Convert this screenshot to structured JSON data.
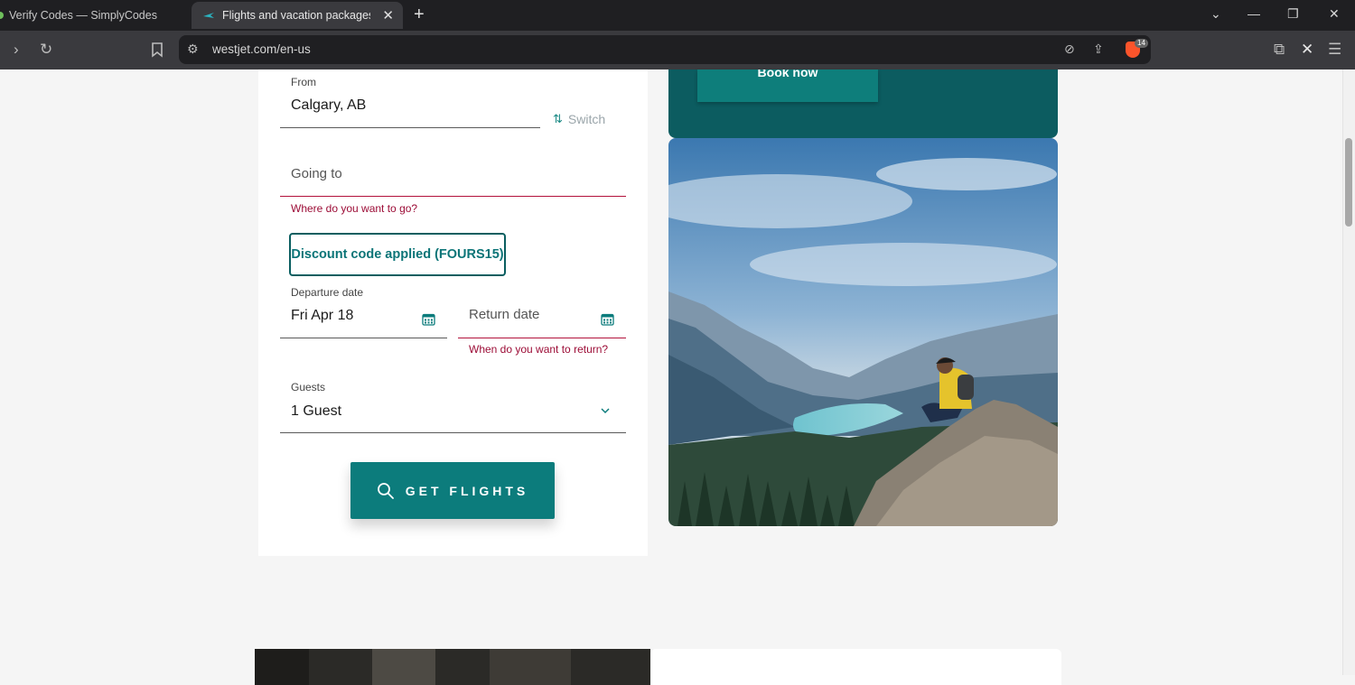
{
  "browser": {
    "tabs": [
      {
        "title": "Verify Codes — SimplyCodes",
        "active": false
      },
      {
        "title": "Flights and vacation packages |",
        "active": true
      }
    ],
    "url": "westjet.com/en-us",
    "shields_count": "14"
  },
  "booking": {
    "from_label": "From",
    "from_value": "Calgary, AB",
    "switch_label": "Switch",
    "going_to_placeholder": "Going to",
    "going_to_error": "Where do you want to go?",
    "discount_text": "Discount code applied (FOURS15)",
    "departure_label": "Departure date",
    "departure_value": "Fri Apr 18",
    "return_placeholder": "Return date",
    "return_error": "When do you want to return?",
    "guests_label": "Guests",
    "guests_value": "1 Guest",
    "submit_label": "GET FLIGHTS"
  },
  "promo": {
    "book_now_label": "Book now"
  },
  "colors": {
    "accent": "#0c7c7c",
    "error": "#9c0c36",
    "promo_bg": "#0c5c60"
  }
}
